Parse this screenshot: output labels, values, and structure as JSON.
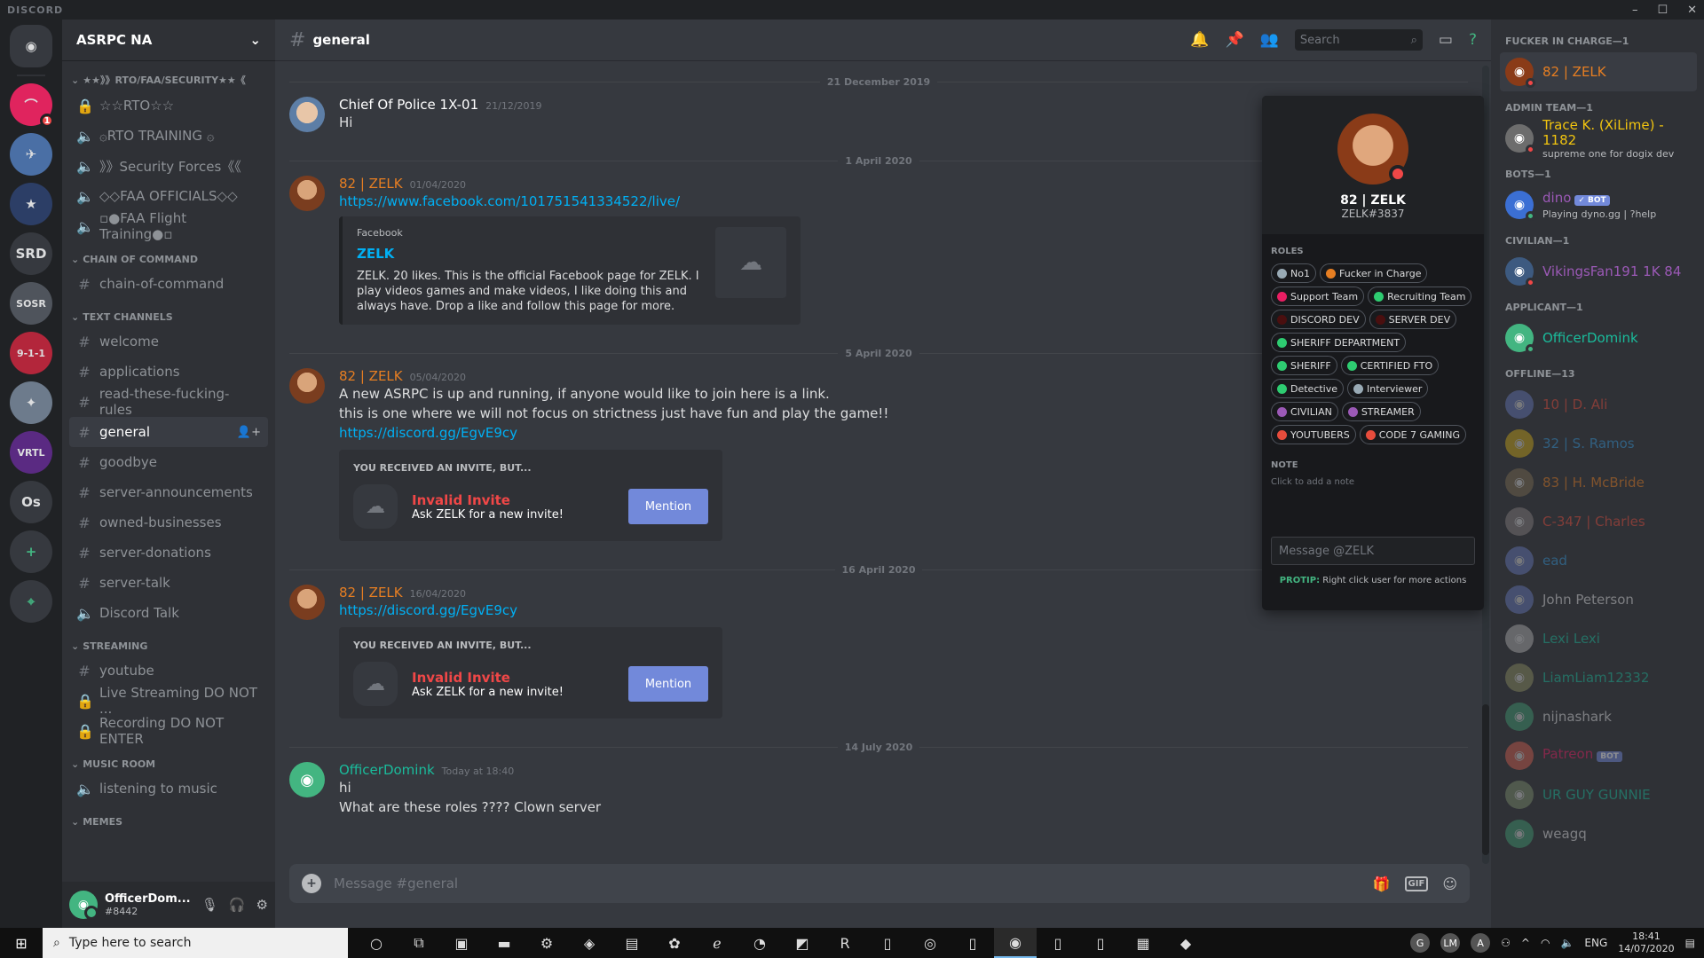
{
  "window": {
    "brand": "DISCORD",
    "min": "–",
    "max": "☐",
    "close": "✕"
  },
  "guilds": [
    {
      "label": "◉",
      "color": "#36393f",
      "home": true
    },
    {
      "label": "⌒",
      "color": "#e0245e",
      "badge": "1"
    },
    {
      "label": "✈",
      "color": "#4a6fa5"
    },
    {
      "label": "★",
      "color": "#2c3e66"
    },
    {
      "label": "SRD",
      "color": "#36393f"
    },
    {
      "label": "SOSR",
      "color": "#4f545c"
    },
    {
      "label": "9-1-1",
      "color": "#b3263b"
    },
    {
      "label": "✦",
      "color": "#6d7b8c"
    },
    {
      "label": "VRTL",
      "color": "#5a2a82"
    },
    {
      "label": "Os",
      "color": "#36393f"
    },
    {
      "label": "+",
      "color": "#36393f",
      "fg": "#43b581"
    },
    {
      "label": "⌖",
      "color": "#36393f",
      "fg": "#43b581"
    }
  ],
  "server": {
    "name": "ASRPC NA",
    "chevron": "⌄"
  },
  "categories": [
    {
      "name": "★★》》RTO/FAA/SECURITY★★《",
      "channels": [
        {
          "type": "lock",
          "name": "☆☆RTO☆☆"
        },
        {
          "type": "voice",
          "name": "۞RTO TRAINING ۞"
        },
        {
          "type": "voice",
          "name": "》》Security Forces《《"
        },
        {
          "type": "voice",
          "name": "◇◇FAA OFFICIALS◇◇"
        },
        {
          "type": "voice",
          "name": "▫●FAA Flight Training●▫"
        }
      ]
    },
    {
      "name": "CHAIN OF COMMAND",
      "channels": [
        {
          "type": "text",
          "name": "chain-of-command"
        }
      ]
    },
    {
      "name": "TEXT CHANNELS",
      "channels": [
        {
          "type": "text",
          "name": "welcome"
        },
        {
          "type": "text",
          "name": "applications"
        },
        {
          "type": "text",
          "name": "read-these-fucking-rules"
        },
        {
          "type": "text",
          "name": "general",
          "active": true
        },
        {
          "type": "text",
          "name": "goodbye"
        },
        {
          "type": "text",
          "name": "server-announcements"
        },
        {
          "type": "text",
          "name": "owned-businesses"
        },
        {
          "type": "text",
          "name": "server-donations"
        },
        {
          "type": "text",
          "name": "server-talk"
        },
        {
          "type": "voice",
          "name": "Discord Talk"
        }
      ]
    },
    {
      "name": "STREAMING",
      "channels": [
        {
          "type": "text",
          "name": "youtube"
        },
        {
          "type": "lock",
          "name": "Live Streaming DO NOT ..."
        },
        {
          "type": "lock",
          "name": "Recording DO NOT ENTER"
        }
      ]
    },
    {
      "name": "MUSIC ROOM",
      "channels": [
        {
          "type": "voice",
          "name": "listening to music"
        }
      ]
    },
    {
      "name": "MEMES",
      "channels": []
    }
  ],
  "user": {
    "name": "OfficerDom...",
    "tag": "#8442"
  },
  "channel": {
    "name": "general"
  },
  "header": {
    "search_placeholder": "Search"
  },
  "messages": [
    {
      "divider": "21 December 2019",
      "author": "Chief Of Police 1X-01",
      "color": "#ffffff",
      "ts": "21/12/2019",
      "avatar": "cop",
      "lines": [
        "Hi"
      ]
    },
    {
      "divider": "1 April 2020",
      "author": "82 | ZELK",
      "color": "#e67e22",
      "ts": "01/04/2020",
      "avatar": "face",
      "link": "https://www.facebook.com/101751541334522/live/",
      "embed": {
        "provider": "Facebook",
        "title": "ZELK",
        "desc": "ZELK. 20 likes. This is the official Facebook page for ZELK. I play videos games and make videos, I like doing this and always have. Drop a like and follow this page for more."
      }
    },
    {
      "divider": "5 April 2020",
      "author": "82 | ZELK",
      "color": "#e67e22",
      "ts": "05/04/2020",
      "avatar": "face",
      "lines": [
        "A new ASRPC is up and running, if anyone would like to join here is a link.",
        "this is one where we will not focus on strictness just have fun and play the game!!"
      ],
      "link": "https://discord.gg/EgvE9cy",
      "invite": {
        "head": "YOU RECEIVED AN INVITE, BUT...",
        "title": "Invalid Invite",
        "sub": "Ask ZELK for a new invite!",
        "button": "Mention"
      }
    },
    {
      "divider": "16 April 2020",
      "author": "82 | ZELK",
      "color": "#e67e22",
      "ts": "16/04/2020",
      "avatar": "face",
      "link": "https://discord.gg/EgvE9cy",
      "invite": {
        "head": "YOU RECEIVED AN INVITE, BUT...",
        "title": "Invalid Invite",
        "sub": "Ask ZELK for a new invite!",
        "button": "Mention"
      }
    },
    {
      "divider": "14 July 2020",
      "author": "OfficerDomink",
      "color": "#1abc9c",
      "ts": "Today at 18:40",
      "avatar": "green",
      "lines": [
        "hi",
        "What are these roles ???? Clown server"
      ]
    }
  ],
  "composer": {
    "placeholder": "Message #general",
    "gif": "GIF"
  },
  "popout": {
    "name": "82 | ZELK",
    "tag": "ZELK#3837",
    "roles_label": "ROLES",
    "roles": [
      {
        "name": "No1",
        "color": "#99aab5"
      },
      {
        "name": "Fucker in Charge",
        "color": "#e67e22"
      },
      {
        "name": "Support Team",
        "color": "#e91e63"
      },
      {
        "name": "Recruiting Team",
        "color": "#2ecc71"
      },
      {
        "name": "DISCORD DEV",
        "color": "#4a0f0f"
      },
      {
        "name": "SERVER DEV",
        "color": "#4a0f0f"
      },
      {
        "name": "SHERIFF DEPARTMENT",
        "color": "#2ecc71"
      },
      {
        "name": "SHERIFF",
        "color": "#2ecc71"
      },
      {
        "name": "CERTIFIED FTO",
        "color": "#2ecc71"
      },
      {
        "name": "Detective",
        "color": "#2ecc71"
      },
      {
        "name": "Interviewer",
        "color": "#99aab5"
      },
      {
        "name": "CIVILIAN",
        "color": "#9b59b6"
      },
      {
        "name": "STREAMER",
        "color": "#9b59b6"
      },
      {
        "name": "YOUTUBERS",
        "color": "#e74c3c"
      },
      {
        "name": "CODE 7 GAMING",
        "color": "#e74c3c"
      }
    ],
    "note_label": "NOTE",
    "note_placeholder": "Click to add a note",
    "message_placeholder": "Message @ZELK",
    "protip_label": "PROTIP:",
    "protip_text": " Right click user for more actions"
  },
  "members": [
    {
      "cat": "FUCKER IN CHARGE—1",
      "items": [
        {
          "name": "82 | ZELK",
          "color": "#e67e22",
          "av": "#8a3b18",
          "status": "#f04747",
          "sel": true
        }
      ]
    },
    {
      "cat": "ADMIN TEAM—1",
      "items": [
        {
          "name": "Trace K. (XiLime) - 1182",
          "color": "#f1c40f",
          "sub": "supreme one for dogix dev",
          "av": "#6d6d6d",
          "status": "#f04747"
        }
      ]
    },
    {
      "cat": "BOTS—1",
      "items": [
        {
          "name": "dino",
          "color": "#9b59b6",
          "bot": "✓ BOT",
          "sub": "Playing dyno.gg | ?help",
          "av": "#3b6fd4",
          "status": "#43b581"
        }
      ]
    },
    {
      "cat": "CIVILIAN—1",
      "items": [
        {
          "name": "VikingsFan191 1K 84",
          "color": "#9b59b6",
          "av": "#3d5a80",
          "status": "#f04747"
        }
      ]
    },
    {
      "cat": "APPLICANT—1",
      "items": [
        {
          "name": "OfficerDomink",
          "color": "#1abc9c",
          "av": "#43b581",
          "status": "#43b581"
        }
      ]
    },
    {
      "cat": "OFFLINE—13",
      "offline": true,
      "items": [
        {
          "name": "10 | D. Ali",
          "color": "#e74c3c",
          "av": "#7289da"
        },
        {
          "name": "32 | S. Ramos",
          "color": "#3498db",
          "av": "#f1c40f"
        },
        {
          "name": "83 | H. McBride",
          "color": "#e67e22",
          "av": "#8e7a56"
        },
        {
          "name": "C-347 | Charles",
          "color": "#e74c3c",
          "av": "#9a8f8f"
        },
        {
          "name": "ead",
          "color": "#3498db",
          "av": "#7289da"
        },
        {
          "name": "John Peterson",
          "color": "#dcddde",
          "av": "#7289da"
        },
        {
          "name": "Lexi Lexi",
          "color": "#1abc9c",
          "av": "#cccccc"
        },
        {
          "name": "LiamLiam12332",
          "color": "#1abc9c",
          "av": "#a3a36b"
        },
        {
          "name": "nijnashark",
          "color": "#dcddde",
          "av": "#43b581"
        },
        {
          "name": "Patreon",
          "color": "#e91e63",
          "bot": "BOT",
          "av": "#f96854"
        },
        {
          "name": "UR GUY GUNNIE",
          "color": "#1abc9c",
          "av": "#8fa37a"
        },
        {
          "name": "weagq",
          "color": "#dcddde",
          "av": "#43b581"
        }
      ]
    }
  ],
  "taskbar": {
    "search_placeholder": "Type here to search",
    "apps": [
      "○",
      "⧉",
      "▣",
      "▬",
      "⚙",
      "◈",
      "▤",
      "✿",
      "ℯ",
      "◔",
      "◩",
      "R",
      "▯",
      "◎",
      "▯",
      "◉",
      "▯",
      "▯",
      "▦",
      "◆"
    ],
    "active_index": 15,
    "tray_avatars": [
      "G",
      "LM",
      "A"
    ],
    "lang": "ENG",
    "time": "18:41",
    "date": "14/07/2020"
  }
}
